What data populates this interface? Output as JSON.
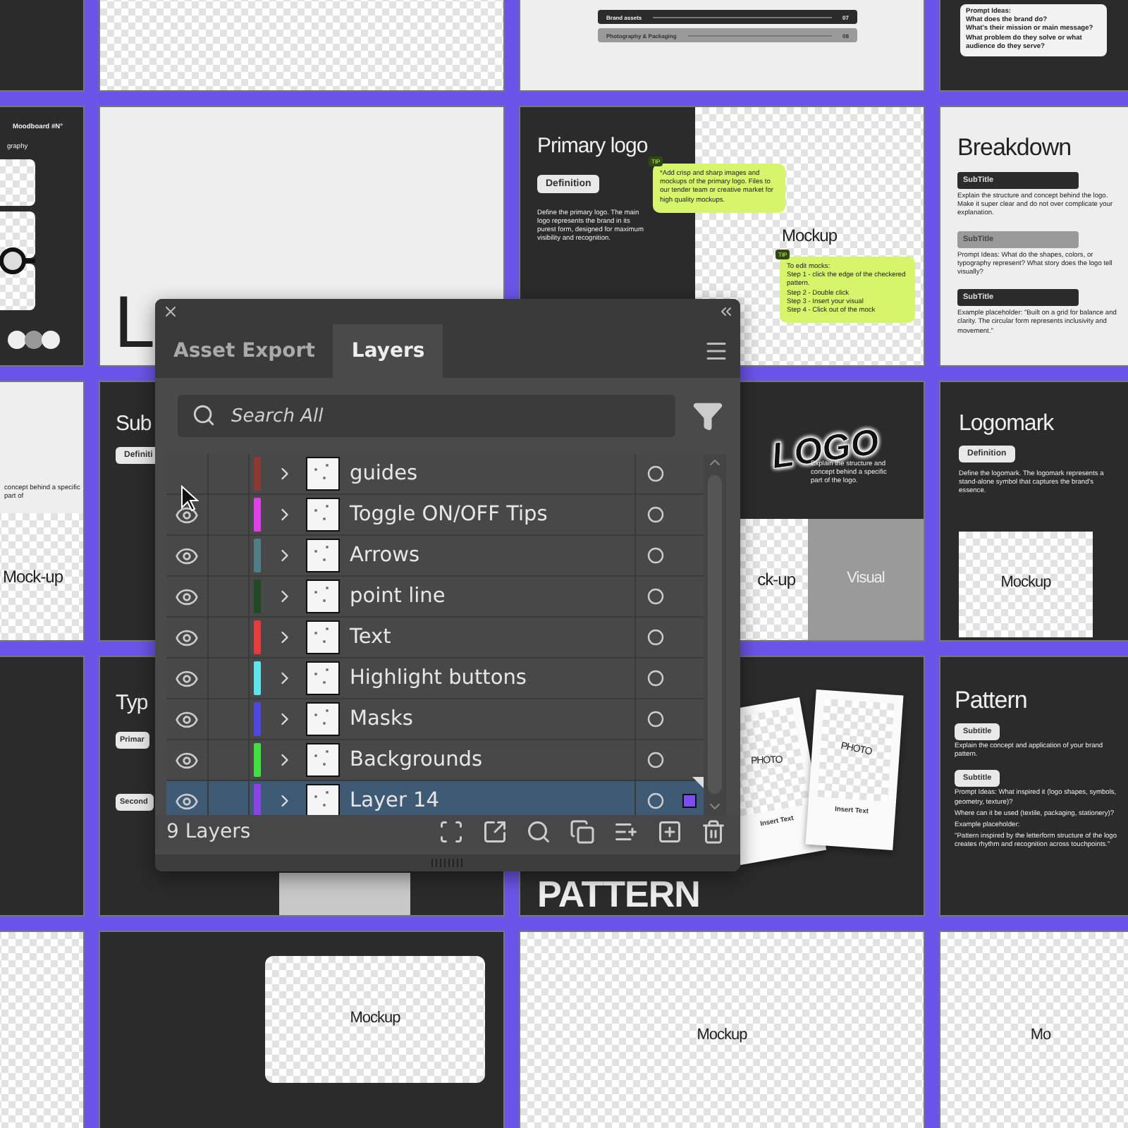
{
  "canvas": {
    "artboards": [
      {
        "kind": "dark"
      },
      {
        "kind": "checker"
      },
      {
        "kind": "index",
        "rows": [
          {
            "label": "Brand assets",
            "page": "07",
            "dimmed": false
          },
          {
            "label": "Photography & Packaging",
            "page": "08",
            "dimmed": true
          }
        ]
      },
      {
        "kind": "prompt",
        "lines": [
          "Prompt Ideas:",
          "What does the brand do?",
          "What's their mission or main message?",
          "What problem do they solve or what audience do they serve?"
        ]
      },
      {
        "kind": "moodboard",
        "title": "Moodboard #N°",
        "label": "graphy"
      },
      {
        "kind": "headline",
        "title": "L"
      },
      {
        "kind": "split",
        "title": "Primary logo",
        "button": "Definition",
        "text": "Define the primary logo. The main logo represents the brand in its purest form, designed for maximum visibility and recognition.",
        "mockup": "Mockup",
        "tips": [
          {
            "tag": "TIP",
            "lines": [
              "*Add crisp and sharp images and mockups of the primary logo. Files to our tender team or creative market for high quality mockups."
            ]
          },
          {
            "tag": "TIP",
            "lines": [
              "To edit mocks:",
              "Step 1 - click the edge of the checkered pattern.",
              "Step 2 - Double click",
              "Step 3 - Insert your visual",
              "Step 4 - Click out of the mock"
            ]
          }
        ]
      },
      {
        "kind": "breakdown",
        "title": "Breakdown",
        "sections": [
          {
            "label": "SubTitle",
            "dimmed": false,
            "text": "Explain the structure and concept behind the logo. Make it super clear and do not over complicate your explanation."
          },
          {
            "label": "SubTitle",
            "dimmed": true,
            "text": "Prompt Ideas: What do the shapes, colors, or typography represent? What story does the logo tell visually?"
          },
          {
            "label": "SubTitle",
            "dimmed": false,
            "text": "Example placeholder: \"Built on a grid for balance and clarity. The circular form represents inclusivity and movement.\""
          }
        ]
      },
      {
        "kind": "caption",
        "text": "concept behind a specific part of",
        "mockup": "Mock-up"
      },
      {
        "kind": "intro",
        "title": "Sub",
        "button": "Definiti"
      },
      {
        "kind": "logo",
        "logo": "LOGO",
        "text": "Explain the structure and concept behind a specific part of the logo.",
        "mockup": "ck-up",
        "visual": "Visual"
      },
      {
        "kind": "logomark",
        "title": "Logomark",
        "button": "Definition",
        "text": "Define the logomark. The logomark represents a stand-alone symbol that captures the brand's essence.",
        "mockup": "Mockup"
      },
      {
        "kind": "dark"
      },
      {
        "kind": "typography",
        "title": "Typ",
        "buttons": [
          "Primar",
          "Second"
        ]
      },
      {
        "kind": "photos",
        "cards": [
          {
            "label": "PHOTO",
            "caption": "Insert Text"
          },
          {
            "label": "PHOTO",
            "caption": "Insert Text"
          }
        ],
        "title": "PATTERN"
      },
      {
        "kind": "pattern",
        "title": "Pattern",
        "sections": [
          {
            "label": "Subtitle",
            "lines": [
              "Explain the concept and application of your brand pattern."
            ]
          },
          {
            "label": "Subtitle",
            "lines": [
              "Prompt Ideas: What inspired it (logo shapes, symbols, geometry, texture)?",
              "Where can it be used (textile, packaging, stationery)?",
              "Example placeholder:",
              "\"Pattern inspired by the letterform structure of the logo creates rhythm and recognition across touchpoints.\""
            ]
          }
        ]
      },
      {
        "kind": "checker"
      },
      {
        "kind": "mockcard",
        "mockup": "Mockup"
      },
      {
        "kind": "checker",
        "label": "Mockup"
      },
      {
        "kind": "checker",
        "label": "Mo"
      }
    ]
  },
  "panel": {
    "tabs": [
      {
        "label": "Asset Export",
        "selected": false
      },
      {
        "label": "Layers",
        "selected": true
      }
    ],
    "search": {
      "placeholder": "Search All"
    },
    "layers": [
      {
        "name": "guides",
        "visible": false,
        "color": "#8a3a30",
        "selected": false
      },
      {
        "name": "Toggle ON/OFF Tips",
        "visible": true,
        "color": "#e040e8",
        "selected": false
      },
      {
        "name": "Arrows",
        "visible": true,
        "color": "#4f7f86",
        "selected": false
      },
      {
        "name": "point line",
        "visible": true,
        "color": "#1f4a22",
        "selected": false
      },
      {
        "name": "Text",
        "visible": true,
        "color": "#e83c3c",
        "selected": false
      },
      {
        "name": "Highlight buttons",
        "visible": true,
        "color": "#5ae6ea",
        "selected": false
      },
      {
        "name": "Masks",
        "visible": true,
        "color": "#4d48e0",
        "selected": false
      },
      {
        "name": "Backgrounds",
        "visible": true,
        "color": "#3fe03f",
        "selected": false
      },
      {
        "name": "Layer 14",
        "visible": true,
        "color": "#8a44e6",
        "selected": true
      }
    ],
    "count": "9 Layers"
  }
}
